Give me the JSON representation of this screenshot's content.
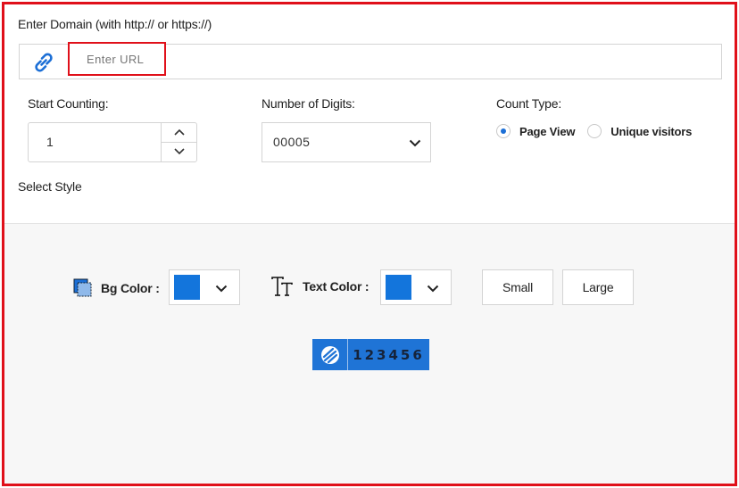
{
  "domain_section": {
    "label": "Enter Domain (with http:// or https://)",
    "url_placeholder": "Enter URL",
    "url_value": ""
  },
  "start_counting": {
    "label": "Start Counting:",
    "value": "1"
  },
  "number_of_digits": {
    "label": "Number of Digits:",
    "selected": "00005"
  },
  "count_type": {
    "label": "Count Type:",
    "options": [
      {
        "label": "Page View",
        "checked": true
      },
      {
        "label": "Unique visitors",
        "checked": false
      }
    ]
  },
  "select_style": {
    "label": "Select Style",
    "bg_color_label": "Bg Color :",
    "bg_color": "#1375dc",
    "text_color_label": "Text Color :",
    "text_color": "#1375dc",
    "size_buttons": [
      "Small",
      "Large"
    ]
  },
  "preview": {
    "digits": "123456",
    "bg": "#1f74d6"
  },
  "colors": {
    "accent": "#1c6fd6",
    "frame_border": "#e0101a"
  }
}
